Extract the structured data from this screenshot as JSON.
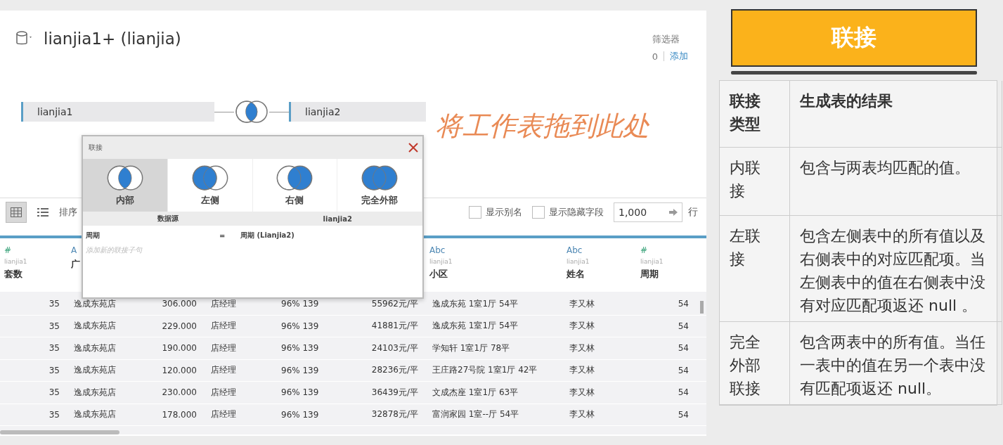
{
  "datasource": {
    "title": "lianjia1+ (lianjia)",
    "filter_label": "筛选器",
    "filter_count": "0",
    "filter_add": "添加"
  },
  "join_diagram": {
    "left_table": "lianjia1",
    "right_table": "lianjia2",
    "drop_hint": "将工作表拖到此处"
  },
  "toolbar": {
    "sort_label": "排序",
    "options": [
      {
        "label": "显示别名",
        "checked": false
      },
      {
        "label": "显示隐藏字段",
        "checked": false
      }
    ],
    "row_count": "1,000",
    "rows_label": "行"
  },
  "grid": {
    "columns": [
      {
        "kind": "number",
        "type_icon": "#",
        "source": "lianjia1",
        "name": "套数"
      },
      {
        "kind": "text",
        "type_icon": "A",
        "name": "广"
      },
      {
        "kind": "number"
      },
      {
        "kind": "text"
      },
      {
        "kind": "text"
      },
      {
        "kind": "number"
      },
      {
        "kind": "text",
        "type_icon": "Abc",
        "source": "lianjia1",
        "name": "小区"
      },
      {
        "kind": "text",
        "type_icon": "Abc",
        "source": "lianjia1",
        "name": "姓名"
      },
      {
        "kind": "number",
        "type_icon": "#",
        "source": "lianjia1",
        "name": "周期"
      }
    ],
    "rows": [
      [
        "35",
        "逸成东苑店",
        "306.000",
        "店经理",
        "96% 139",
        "55962元/平",
        "逸成东苑 1室1厅 54平",
        "李又林",
        "54"
      ],
      [
        "35",
        "逸成东苑店",
        "229.000",
        "店经理",
        "96% 139",
        "41881元/平",
        "逸成东苑 1室1厅 54平",
        "李又林",
        "54"
      ],
      [
        "35",
        "逸成东苑店",
        "190.000",
        "店经理",
        "96% 139",
        "24103元/平",
        "学知轩 1室1厅 78平",
        "李又林",
        "54"
      ],
      [
        "35",
        "逸成东苑店",
        "120.000",
        "店经理",
        "96% 139",
        "28236元/平",
        "王庄路27号院 1室1厅 42平",
        "李又林",
        "54"
      ],
      [
        "35",
        "逸成东苑店",
        "230.000",
        "店经理",
        "96% 139",
        "36439元/平",
        "文成杰座 1室1厅 63平",
        "李又林",
        "54"
      ],
      [
        "35",
        "逸成东苑店",
        "178.000",
        "店经理",
        "96% 139",
        "32878元/平",
        "富润家园 1室--厅 54平",
        "李又林",
        "54"
      ]
    ]
  },
  "join_dialog": {
    "title": "联接",
    "options": [
      {
        "label": "内部",
        "kind": "inner",
        "selected": true
      },
      {
        "label": "左侧",
        "kind": "left",
        "selected": false
      },
      {
        "label": "右侧",
        "kind": "right",
        "selected": false
      },
      {
        "label": "完全外部",
        "kind": "full",
        "selected": false
      }
    ],
    "clause_columns": [
      "数据源",
      "lianjia2"
    ],
    "clauses": [
      {
        "left": "周期",
        "operator": "=",
        "right": "周期 (Lianjia2)"
      }
    ],
    "add_clause_placeholder": "添加新的联接子句"
  },
  "join_button": "联接",
  "reference_table": {
    "headers": [
      "联接类型",
      "生成表的结果"
    ],
    "rows": [
      [
        "内联接",
        "包含与两表均匹配的值。"
      ],
      [
        "左联接",
        "包含左侧表中的所有值以及右侧表中的对应匹配项。当左侧表中的值在右侧表中没有对应匹配项返还 null 。"
      ],
      [
        "完全外部联接",
        "包含两表中的所有值。当任一表中的值在另一个表中没有匹配项返还 null。"
      ]
    ]
  }
}
